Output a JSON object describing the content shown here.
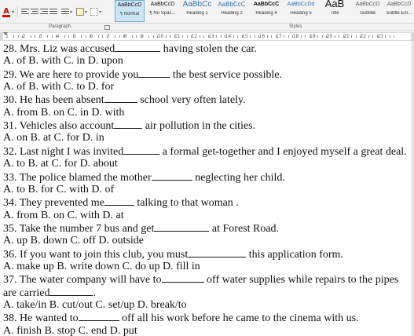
{
  "ribbon": {
    "paragraph_label": "Paragraph",
    "styles_label": "Styles",
    "font_color_glyph": "A",
    "styles": [
      {
        "preview": "AaBbCcD",
        "name": "¶ Normal",
        "active": true
      },
      {
        "preview": "AaBbCcD",
        "name": "¶ No Spac..."
      },
      {
        "preview": "AaBbCc",
        "name": "Heading 1"
      },
      {
        "preview": "AaBbCcC",
        "name": "Heading 2"
      },
      {
        "preview": "AaBbCcC",
        "name": "Heading 4"
      },
      {
        "preview": "AaBbCcDd",
        "name": "Heading 5"
      },
      {
        "preview": "AaB",
        "name": "Title"
      },
      {
        "preview": "AaBbCcD",
        "name": "Subtitle"
      },
      {
        "preview": "AaBbCcD",
        "name": "Subtle Em..."
      }
    ]
  },
  "ruler": {
    "numbers": [
      "1",
      "2",
      "3",
      "4",
      "5",
      "6",
      "7",
      "8",
      "9",
      "10",
      "11",
      "12",
      "13",
      "14",
      "15",
      "16",
      "17",
      "18",
      "19",
      "20",
      "21",
      "22",
      "23"
    ]
  },
  "document": {
    "lines": [
      {
        "a": "28. Mrs. Liz was accused",
        "blank": "_",
        "b": " having stolen the car."
      },
      {
        "a": "A. of B. with C. in D. upon"
      },
      {
        "a": "29. We are here to provide you",
        "blank": "_",
        "b": " the best service possible."
      },
      {
        "a": "A. of B. with C. to D. for"
      },
      {
        "a": "30. He has been absent",
        "blank": "_",
        "b": " school very often lately."
      },
      {
        "a": "A. from B. on C. in D. with"
      },
      {
        "a": "31. Vehicles also account",
        "blank": "_",
        "b": " air pollution in the cities."
      },
      {
        "a": "A. on B. at C. for D. in"
      },
      {
        "a": "32. Last night I was invited",
        "blank": "_",
        "b": " a formal get-together and I enjoyed myself a great deal."
      },
      {
        "a": "A. to B. at C. for D. about"
      },
      {
        "a": "33. The police blamed the mother",
        "blank": "_",
        "b": " neglecting her child."
      },
      {
        "a": "A. to B. for C. with D. of"
      },
      {
        "a": "34. They prevented me",
        "blank": "_",
        "b": " talking to that woman ."
      },
      {
        "a": "A. from B. on C. with D. at"
      },
      {
        "a": "35. Take the number 7 bus and get",
        "blank": "_",
        "b": " at Forest Road."
      },
      {
        "a": "A. up B. down C. off D. outside"
      },
      {
        "a": "36. If you want to join this club, you must",
        "blank": "_",
        "b": " this application form."
      },
      {
        "a": "A. make up B. write down C. do up D. fill in"
      },
      {
        "a": "37. The water company will have to",
        "blank": "_",
        "b": " off water supplies while repairs to the pipes"
      },
      {
        "a": "are carried",
        "blank": "_",
        "b": "."
      },
      {
        "a": "A. take/in B. cut/out C. set/up D. break/to"
      },
      {
        "a": "38. He wanted to",
        "blank": "_",
        "b": " off all his work before he came to the cinema with us."
      },
      {
        "a": "A. finish B. stop C. end D. put"
      }
    ]
  }
}
